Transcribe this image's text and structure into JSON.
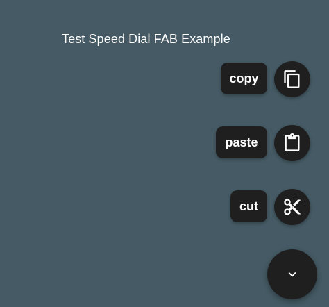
{
  "header": {
    "title": "Test Speed Dial FAB Example"
  },
  "speed_dial": {
    "actions": [
      {
        "label": "copy",
        "icon": "copy-icon"
      },
      {
        "label": "paste",
        "icon": "clipboard-icon"
      },
      {
        "label": "cut",
        "icon": "scissors-icon"
      }
    ],
    "main_fab_icon": "chevron-down-icon",
    "expanded": true
  },
  "colors": {
    "background": "#455a64",
    "fab": "#1f1f1f",
    "text": "#ffffff"
  }
}
